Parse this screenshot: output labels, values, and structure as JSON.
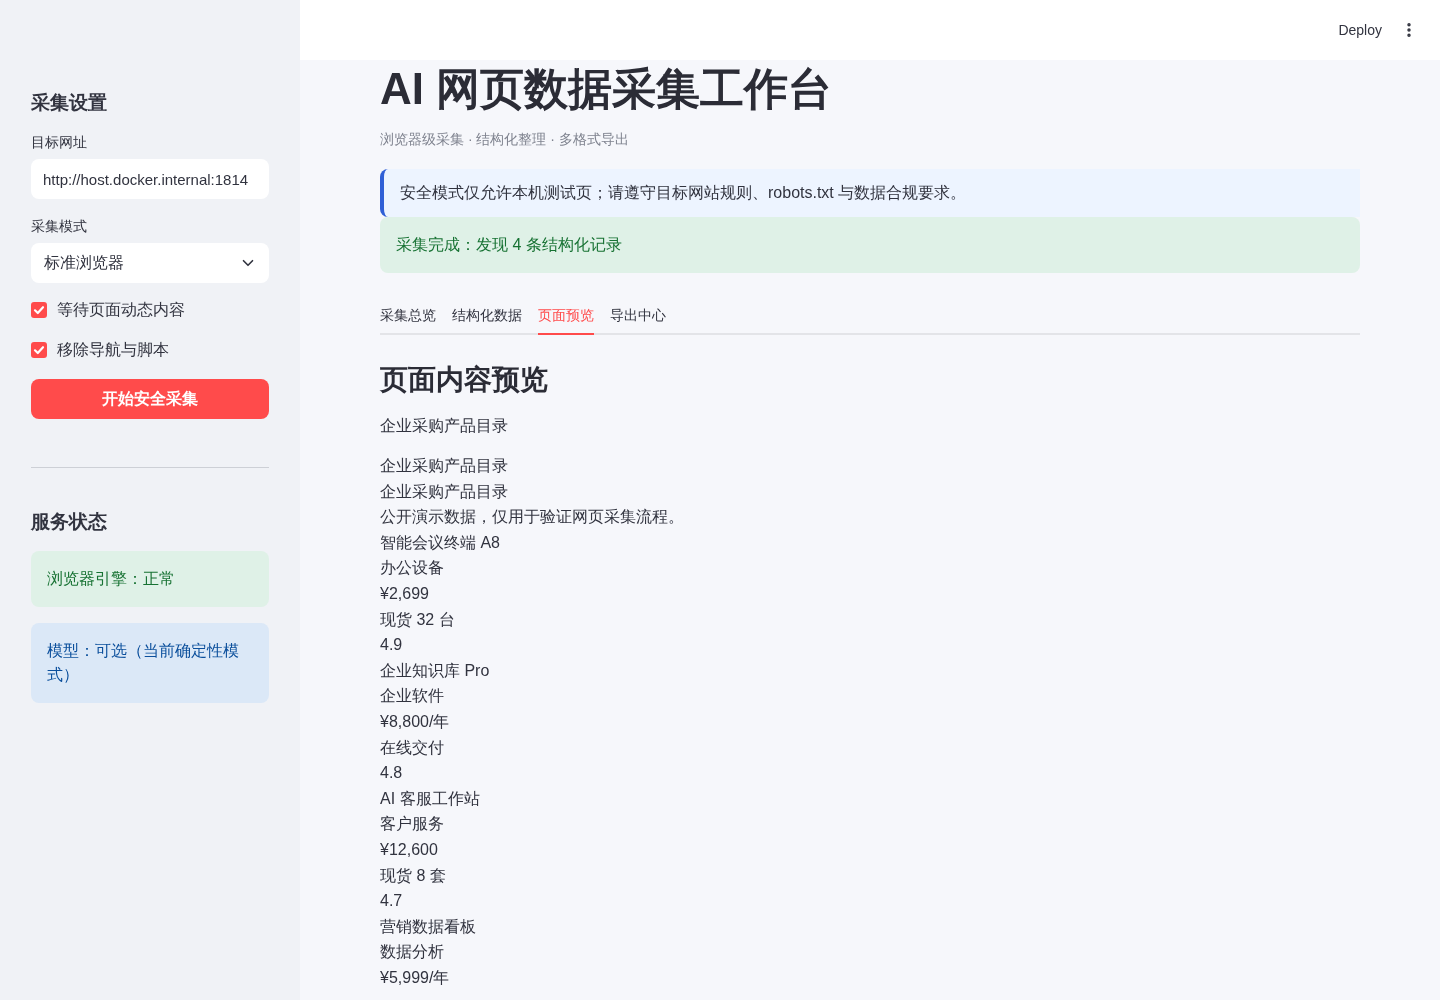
{
  "header": {
    "deploy": "Deploy"
  },
  "sidebar": {
    "settings_title": "采集设置",
    "url_field": {
      "label": "目标网址",
      "value": "http://host.docker.internal:1814"
    },
    "mode_select": {
      "label": "采集模式",
      "value": "标准浏览器"
    },
    "checkboxes": [
      {
        "label": "等待页面动态内容",
        "checked": true
      },
      {
        "label": "移除导航与脚本",
        "checked": true
      }
    ],
    "start_button": "开始安全采集",
    "status_title": "服务状态",
    "status_alerts": [
      {
        "kind": "success",
        "text": "浏览器引擎：正常"
      },
      {
        "kind": "info",
        "text": "模型：可选（当前确定性模式）"
      }
    ]
  },
  "main": {
    "title": "AI 网页数据采集工作台",
    "subtitle": "浏览器级采集 · 结构化整理 · 多格式导出",
    "alerts": [
      {
        "kind": "notice",
        "text": "安全模式仅允许本机测试页；请遵守目标网站规则、robots.txt 与数据合规要求。"
      },
      {
        "kind": "success",
        "text": "采集完成：发现 4 条结构化记录"
      }
    ],
    "tabs": [
      {
        "label": "采集总览",
        "selected": false
      },
      {
        "label": "结构化数据",
        "selected": false
      },
      {
        "label": "页面预览",
        "selected": true
      },
      {
        "label": "导出中心",
        "selected": false
      }
    ],
    "preview": {
      "heading": "页面内容预览",
      "intro": "企业采购产品目录",
      "lines": [
        "企业采购产品目录",
        "企业采购产品目录",
        "公开演示数据，仅用于验证网页采集流程。",
        "智能会议终端 A8",
        "办公设备",
        "¥2,699",
        "现货 32 台",
        "4.9",
        "企业知识库 Pro",
        "企业软件",
        "¥8,800/年",
        "在线交付",
        "4.8",
        "AI 客服工作站",
        "客户服务",
        "¥12,600",
        "现货 8 套",
        "4.7",
        "营销数据看板",
        "数据分析",
        "¥5,999/年"
      ]
    }
  }
}
